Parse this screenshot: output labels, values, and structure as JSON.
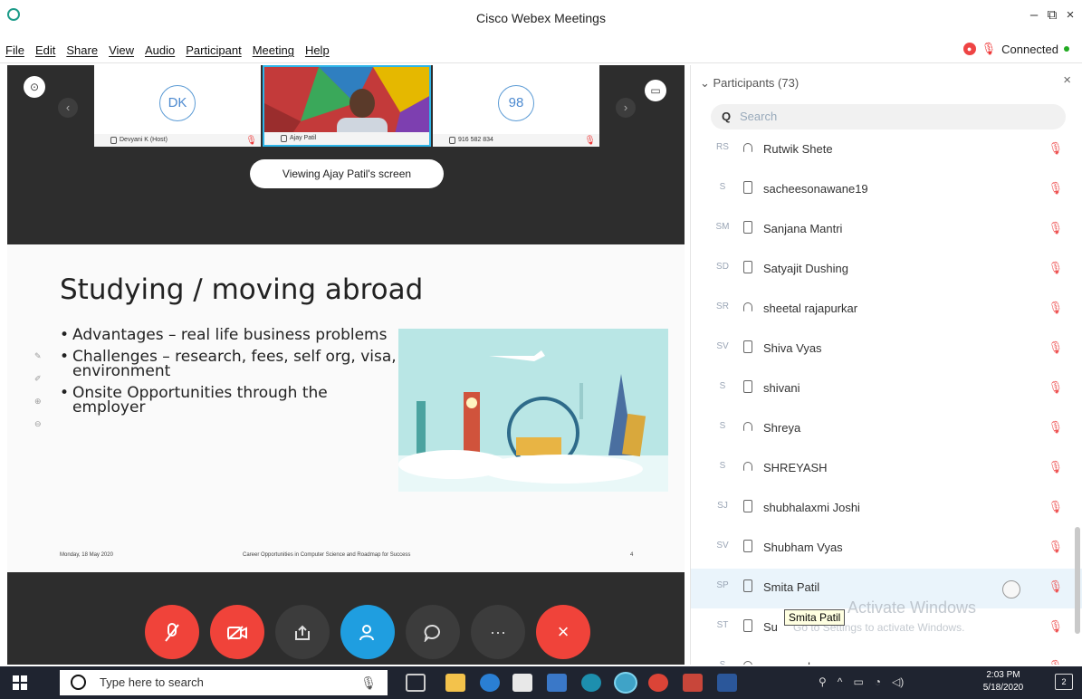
{
  "window": {
    "title": "Cisco Webex Meetings",
    "minimize": "–",
    "restore": "⧉",
    "close": "×"
  },
  "menu": [
    "File",
    "Edit",
    "Share",
    "View",
    "Audio",
    "Participant",
    "Meeting",
    "Help"
  ],
  "status": {
    "connection": "Connected",
    "rec_badge": "●"
  },
  "thumbnails": [
    {
      "initials": "DK",
      "caption": "Devyani K (Host)"
    },
    {
      "initials": "",
      "caption": "Ajay Patil"
    },
    {
      "initials": "98",
      "caption": "916 582 834"
    }
  ],
  "viewing_label": "Viewing Ajay Patil's screen",
  "slide": {
    "title": "Studying / moving abroad",
    "bullets": [
      "Advantages – real life business problems",
      "Challenges – research, fees, self org, visa, environment",
      "Onsite Opportunities through the employer"
    ],
    "footer_date": "Monday, 18 May 2020",
    "footer_center": "Career Opportunities in Computer Science and Roadmap for Success",
    "footer_page": "4"
  },
  "controls": [
    "mute",
    "stop-video",
    "share",
    "participants",
    "chat",
    "more",
    "leave"
  ],
  "participants": {
    "header": "Participants (73)",
    "search_placeholder": "Search",
    "list": [
      {
        "initials": "RS",
        "name": "Rutwik Shete",
        "device": "headset"
      },
      {
        "initials": "S",
        "name": "sacheesonawane19",
        "device": "phone"
      },
      {
        "initials": "SM",
        "name": "Sanjana Mantri",
        "device": "phone"
      },
      {
        "initials": "SD",
        "name": "Satyajit Dushing",
        "device": "phone"
      },
      {
        "initials": "SR",
        "name": "sheetal rajapurkar",
        "device": "headset"
      },
      {
        "initials": "SV",
        "name": "Shiva Vyas",
        "device": "phone"
      },
      {
        "initials": "S",
        "name": "shivani",
        "device": "phone"
      },
      {
        "initials": "S",
        "name": "Shreya",
        "device": "headset"
      },
      {
        "initials": "S",
        "name": "SHREYASH",
        "device": "headset"
      },
      {
        "initials": "SJ",
        "name": "shubhalaxmi Joshi",
        "device": "phone"
      },
      {
        "initials": "SV",
        "name": "Shubham Vyas",
        "device": "phone"
      },
      {
        "initials": "SP",
        "name": "Smita Patil",
        "device": "phone"
      },
      {
        "initials": "ST",
        "name": "Su",
        "device": "phone"
      },
      {
        "initials": "S",
        "name": "swanand",
        "device": "headset"
      }
    ],
    "tooltip": "Smita Patil"
  },
  "watermark": {
    "line1": "Activate Windows",
    "line2": "Go to Settings to activate Windows."
  },
  "taskbar": {
    "search_placeholder": "Type here to search",
    "time": "2:03 PM",
    "date": "5/18/2020",
    "notifications": "2"
  }
}
